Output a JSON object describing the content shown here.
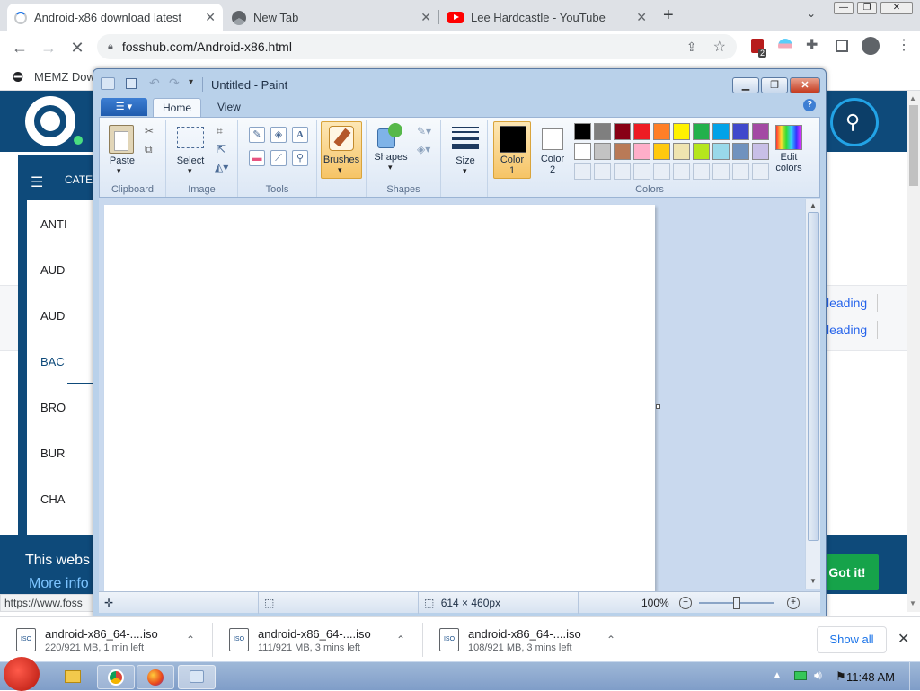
{
  "browser": {
    "tabs": [
      {
        "title": "Android-x86 download latest",
        "icon": "loading-spinner-icon",
        "active": true
      },
      {
        "title": "New Tab",
        "icon": "chrome-icon",
        "active": false
      },
      {
        "title": "Lee Hardcastle - YouTube",
        "icon": "youtube-icon",
        "active": false
      }
    ],
    "url": "fosshub.com/Android-x86.html",
    "bookmark": "MEMZ Dow",
    "extension_badge": "2",
    "status_url": "https://www.foss"
  },
  "webpage": {
    "category_header": "CATE",
    "categories": [
      "ANTI",
      "AUD",
      "AUD",
      "BAC",
      "BRO",
      "BUR",
      "CHA"
    ],
    "right_links": [
      "leading",
      "leading"
    ],
    "cookie_text": "This webs",
    "more_info": "More info",
    "got_it": "Got it!"
  },
  "paint": {
    "title": "Untitled - Paint",
    "tabs": [
      "Home",
      "View"
    ],
    "groups": {
      "clipboard": "Clipboard",
      "image": "Image",
      "tools": "Tools",
      "shapes": "Shapes",
      "colors": "Colors"
    },
    "buttons": {
      "paste": "Paste",
      "select": "Select",
      "brushes": "Brushes",
      "shapes": "Shapes",
      "size": "Size",
      "color1_line1": "Color",
      "color1_line2": "1",
      "color2_line1": "Color",
      "color2_line2": "2",
      "edit_colors_line1": "Edit",
      "edit_colors_line2": "colors"
    },
    "palette_row1": [
      "#000000",
      "#7f7f7f",
      "#880015",
      "#ed1c24",
      "#ff7f27",
      "#fff200",
      "#22b14c",
      "#00a2e8",
      "#3f48cc",
      "#a349a4"
    ],
    "palette_row2": [
      "#ffffff",
      "#c3c3c3",
      "#b97a57",
      "#ffaec9",
      "#ffc90e",
      "#efe4b0",
      "#b5e61d",
      "#99d9ea",
      "#7092be",
      "#c8bfe7"
    ],
    "color1": "#000000",
    "color2": "#ffffff",
    "canvas_size": "614 × 460px",
    "zoom": "100%"
  },
  "downloads": [
    {
      "name": "android-x86_64-....iso",
      "status": "220/921 MB, 1 min left"
    },
    {
      "name": "android-x86_64-....iso",
      "status": "111/921 MB, 3 mins left"
    },
    {
      "name": "android-x86_64-....iso",
      "status": "108/921 MB, 3 mins left"
    }
  ],
  "show_all": "Show all",
  "taskbar": {
    "clock": "11:48 AM"
  }
}
